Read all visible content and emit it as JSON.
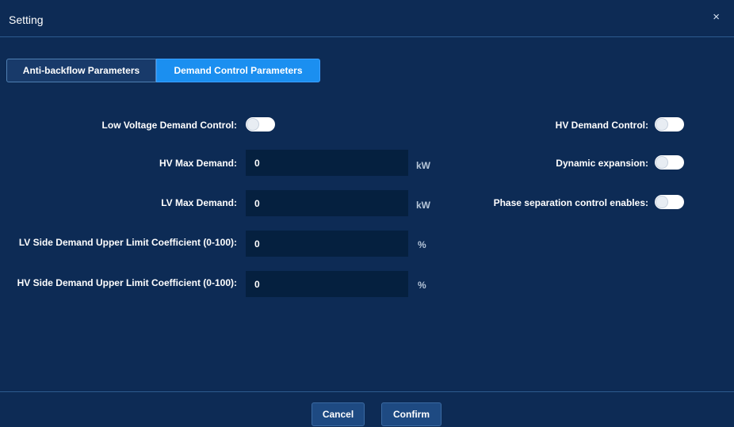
{
  "dialog": {
    "title": "Setting",
    "close_icon": "×"
  },
  "tabs": [
    {
      "label": "Anti-backflow Parameters",
      "active": false
    },
    {
      "label": "Demand Control Parameters",
      "active": true
    }
  ],
  "left": {
    "lv_demand_control": {
      "label": "Low Voltage Demand Control:",
      "enabled": false
    },
    "hv_max_demand": {
      "label": "HV Max Demand:",
      "value": "0",
      "unit": "kW"
    },
    "lv_max_demand": {
      "label": "LV Max Demand:",
      "value": "0",
      "unit": "kW"
    },
    "lv_upper_coeff": {
      "label": "LV Side Demand Upper Limit Coefficient (0-100):",
      "value": "0",
      "unit": "%"
    },
    "hv_upper_coeff": {
      "label": "HV Side Demand Upper Limit Coefficient (0-100):",
      "value": "0",
      "unit": "%"
    }
  },
  "right": {
    "hv_demand_control": {
      "label": "HV Demand Control:",
      "enabled": false
    },
    "dynamic_expansion": {
      "label": "Dynamic expansion:",
      "enabled": false
    },
    "phase_separation": {
      "label": "Phase separation control enables:",
      "enabled": false
    }
  },
  "footer": {
    "cancel_label": "Cancel",
    "confirm_label": "Confirm"
  }
}
